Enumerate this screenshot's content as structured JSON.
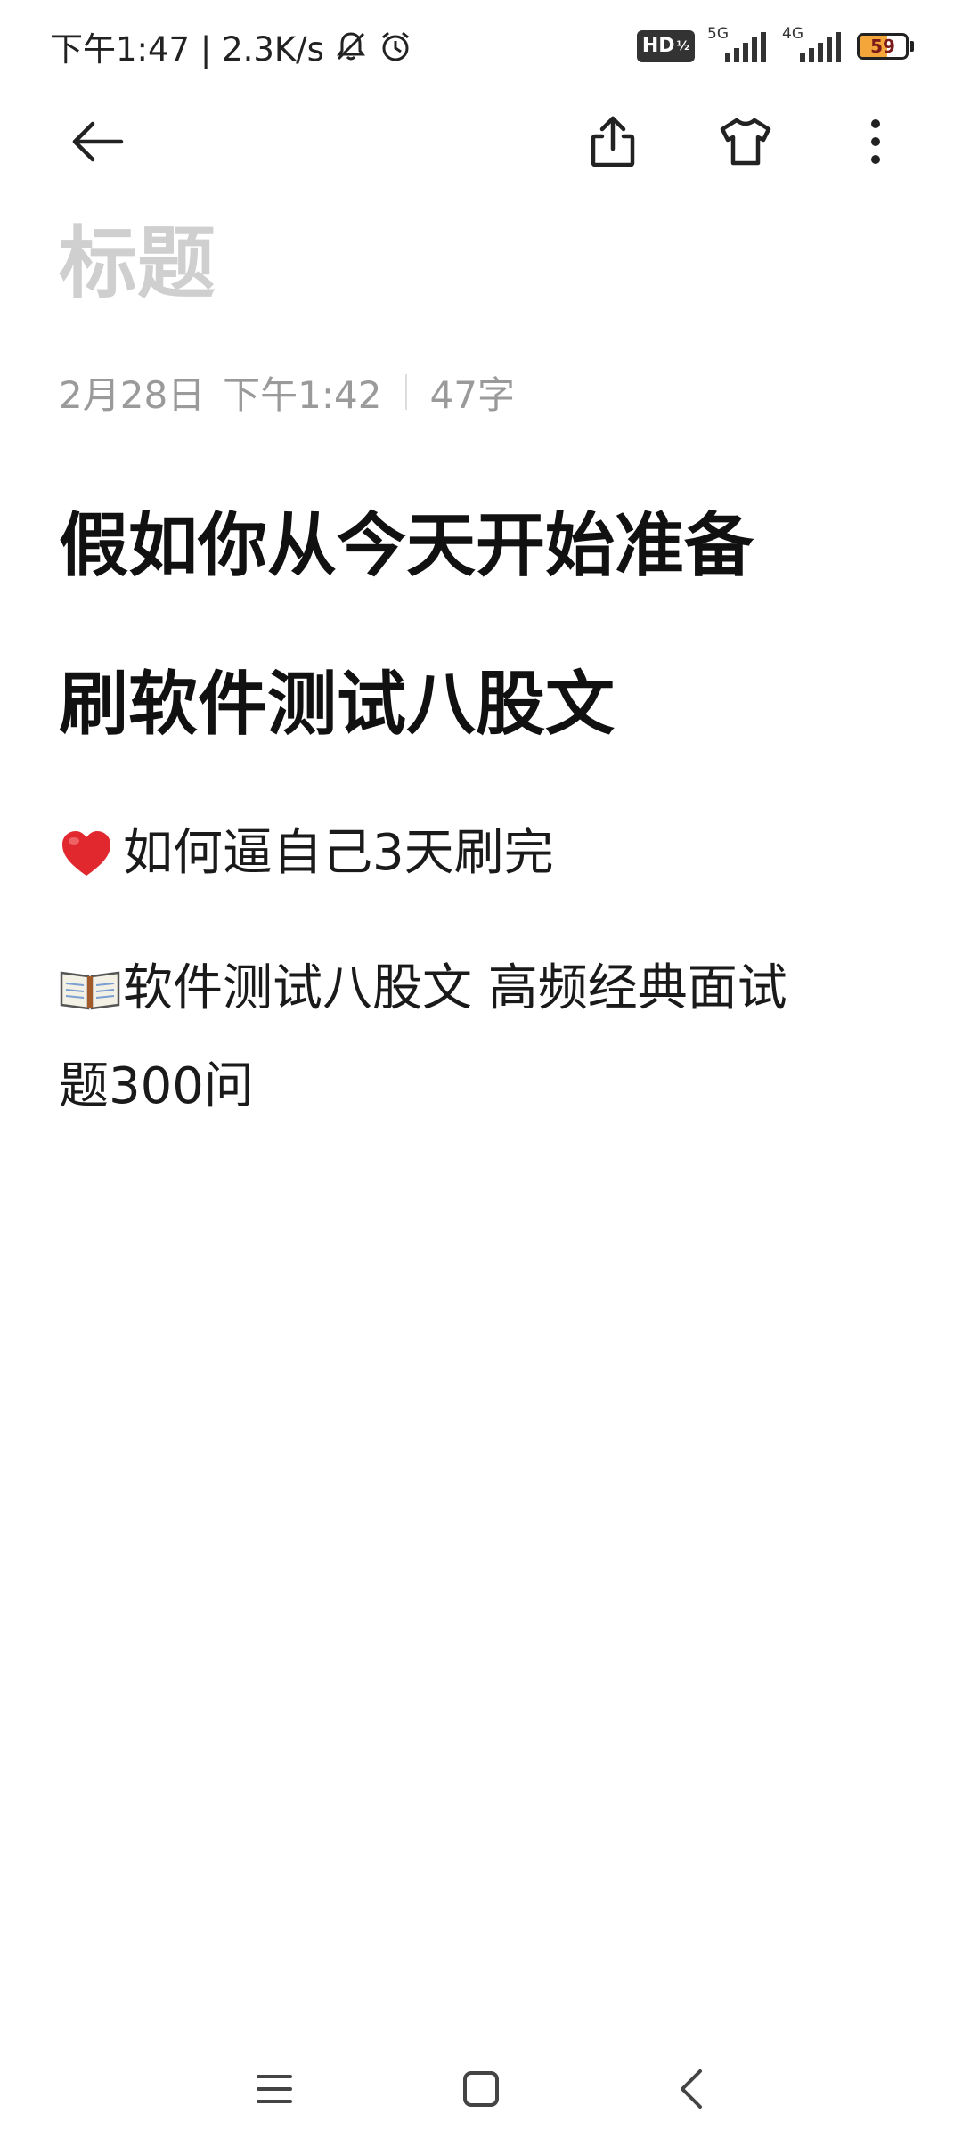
{
  "status_bar": {
    "time_speed": "下午1:47 | 2.3K/s",
    "hd_label": "HD",
    "network_1": "5G",
    "network_2": "4G",
    "battery_percent": "59",
    "battery_level": 0.59,
    "battery_color": "#f4a63a"
  },
  "toolbar": {
    "back_icon": "arrow-left-icon",
    "share_icon": "share-icon",
    "theme_icon": "tshirt-icon",
    "more_icon": "more-vertical-icon"
  },
  "note": {
    "title_placeholder": "标题",
    "date": "2月28日",
    "time": "下午1:42",
    "word_count": "47字",
    "heading_line_1": "假如你从今天开始准备",
    "heading_line_2": "刷软件测试八股文",
    "line_1_text": "如何逼自己3天刷完",
    "line_1_icon": "heart-icon",
    "line_2_text": "软件测试八股文 高频经典面试",
    "line_2_icon": "book-icon",
    "line_3_text": "题300问"
  },
  "nav_bar": {
    "menu_icon": "menu-icon",
    "home_icon": "home-square-icon",
    "back_icon": "chevron-left-icon"
  }
}
